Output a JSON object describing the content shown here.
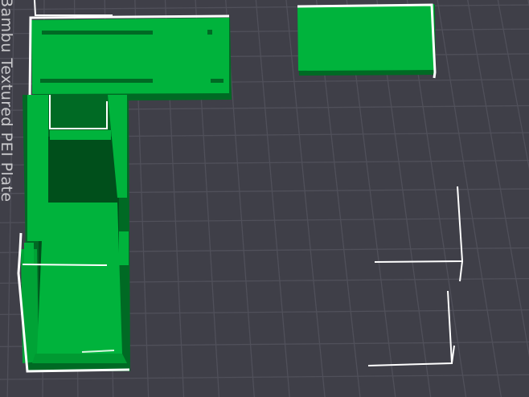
{
  "viewport": {
    "plate_name": "Bambu Textured PEI Plate",
    "grid_color": "#50505a",
    "background_color": "#3f3f48",
    "part_color": "#00b33c",
    "part_shadow_color": "#006a24",
    "part_dark_color": "#004f1b",
    "selection_color": "#ffffff"
  }
}
